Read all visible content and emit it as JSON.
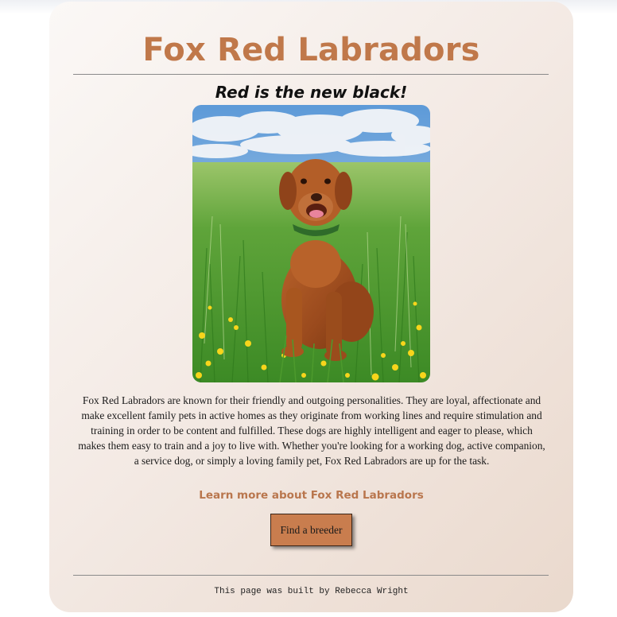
{
  "page": {
    "title": "Fox Red Labradors",
    "subtitle": "Red is the new black!",
    "description": "Fox Red Labradors are known for their friendly and outgoing personalities. They are loyal, affectionate and make excellent family pets in active homes as they originate from working lines and require stimulation and training in order to be content and fulfilled. These dogs are highly intelligent and eager to please, which makes them easy to train and a joy to live with. Whether you're looking for a working dog, active companion, a service dog, or simply a loving family pet, Fox Red Labradors are up for the task.",
    "learn_more_link": "Learn more about Fox Red Labradors",
    "breeder_button": "Find a breeder",
    "footer": "This page was built by Rebecca Wright"
  },
  "image": {
    "icon": "dog-photo",
    "alt": "Fox red labrador sitting in a meadow of long grass and buttercups"
  },
  "colors": {
    "accent": "#c0784a",
    "link": "#b9764d",
    "button": "#c97d4e",
    "text": "#1a1a1a"
  }
}
